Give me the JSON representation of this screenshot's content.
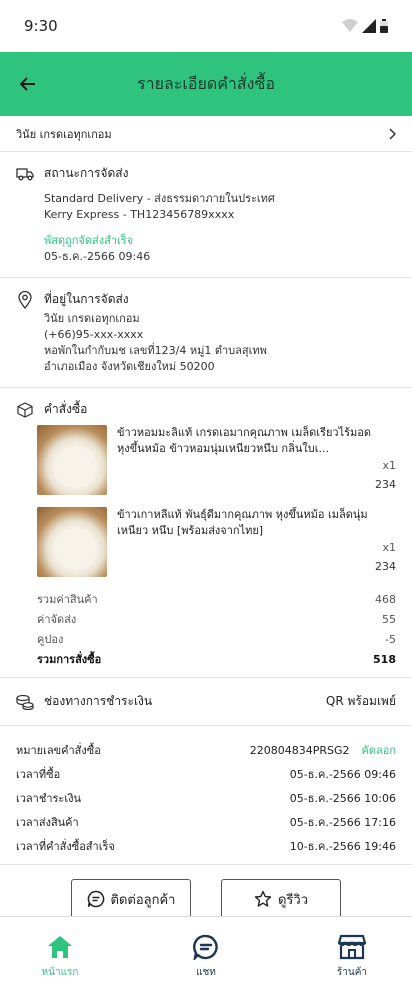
{
  "status_bar": {
    "time": "9:30"
  },
  "header": {
    "title": "รายละเอียดคำสั่งซื้อ"
  },
  "customer": {
    "name": "วินัย เกรดเอทุกเกอม"
  },
  "shipping": {
    "title": "สถานะการจัดส่ง",
    "method": "Standard Delivery - ส่งธรรมดาภายในประเทศ",
    "carrier": "Kerry Express - TH123456789xxxx",
    "status": "พัสดุถูกจัดส่งสำเร็จ",
    "datetime": "05-ธ.ค.-2566  09:46"
  },
  "address": {
    "title": "ที่อยู่ในการจัดส่ง",
    "name": "วินัย เกรดเอทุกเกอม",
    "phone": "(+66)95-xxx-xxxx",
    "line1": "หอพักในกำกับมช เลขที่123/4 หมู่1 ตำบลสุเทพ",
    "line2": "อำเภอเมือง จังหวัดเชียงใหม่ 50200"
  },
  "order": {
    "title": "คำสั่งซื้อ",
    "items": [
      {
        "name": "ข้าวหอมมะลิแท้ เกรดเอมากคุณภาพ เมล็ดเรียวไร้มอด หุงขึ้นหม้อ  ข้าวหอมนุ่มเหนียวหนึบ กลิ่นใบเ...",
        "qty": "x1",
        "price": "234"
      },
      {
        "name": "ข้าวเกาหลีแท้ พันธุ์ดีมากคุณภาพ หุงขึ้นหม้อ เมล็ดนุ่มเหนียว หนึบ [พร้อมส่งจากไทย]",
        "qty": "x1",
        "price": "234"
      }
    ],
    "summary": [
      {
        "label": "รวมค่าสินค้า",
        "value": "468"
      },
      {
        "label": "ค่าจัดส่ง",
        "value": "55"
      },
      {
        "label": "คูปอง",
        "value": "-5"
      }
    ],
    "total_label": "รวมการสั่งซื้อ",
    "total_value": "518"
  },
  "payment": {
    "title": "ช่องทางการชำระเงิน",
    "method": "QR พร้อมเพย์"
  },
  "info": {
    "order_no_label": "หมายเลขคำสั่งซื้อ",
    "order_no": "220804834PRSG2",
    "copy_label": "คัดลอก",
    "rows": [
      {
        "label": "เวลาที่ซื้อ",
        "value": "05-ธ.ค.-2566  09:46"
      },
      {
        "label": "เวลาชำระเงิน",
        "value": "05-ธ.ค.-2566  10:06"
      },
      {
        "label": "เวลาส่งสินค้า",
        "value": "05-ธ.ค.-2566  17:16"
      },
      {
        "label": "เวลาที่คำสั่งซื้อสำเร็จ",
        "value": "10-ธ.ค.-2566  19:46"
      }
    ]
  },
  "actions": {
    "contact": "ติดต่อลูกค้า",
    "review": "ดูรีวิว"
  },
  "nav": {
    "home": "หน้าแรก",
    "chat": "แชท",
    "shop": "ร้านค้า"
  },
  "colors": {
    "accent": "#2ec47e",
    "nav_dark": "#1e3554"
  }
}
